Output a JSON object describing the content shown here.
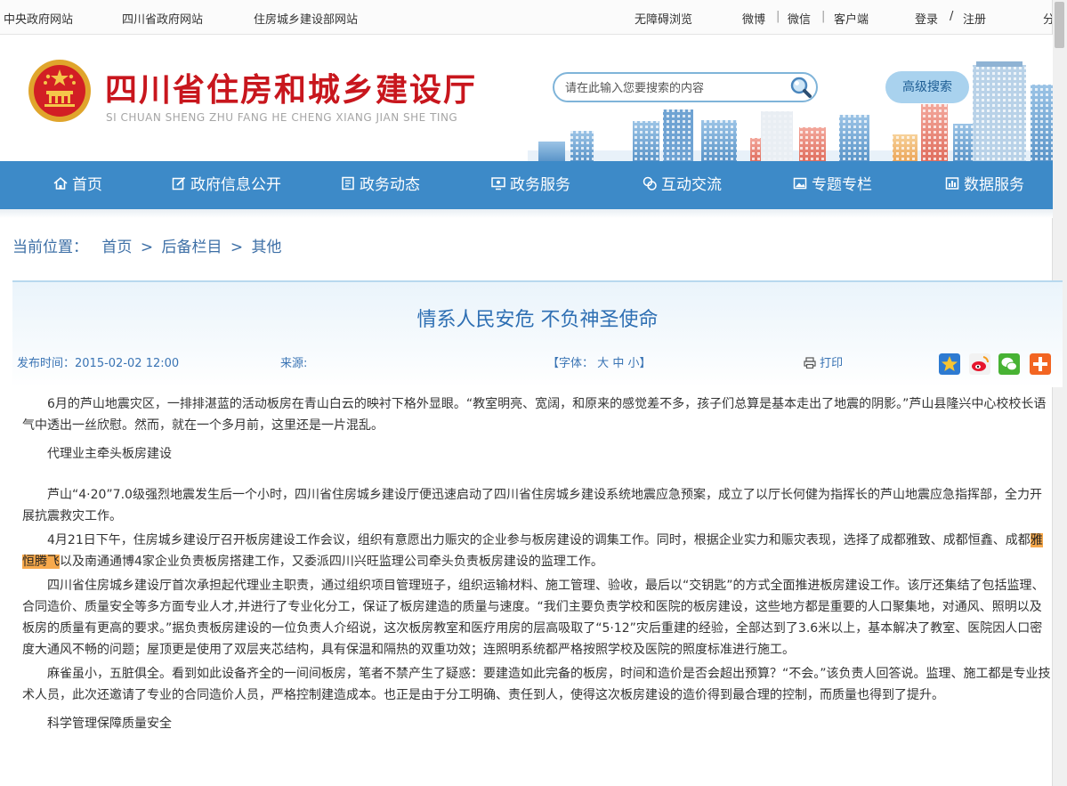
{
  "topbar": {
    "links": [
      "中央政府网站",
      "四川省政府网站",
      "住房城乡建设部网站"
    ],
    "accessibility": "无障碍浏览",
    "weibo": "微博",
    "wechat": "微信",
    "client": "客户端",
    "login": "登录",
    "slash": "/",
    "register": "注册",
    "cut_off": "分",
    "sep": "|"
  },
  "header": {
    "title": "四川省住房和城乡建设厅",
    "pinyin": "SI CHUAN SHENG ZHU FANG HE CHENG XIANG JIAN SHE TING",
    "search_placeholder": "请在此输入您要搜索的内容",
    "advanced_search": "高级搜索"
  },
  "nav": {
    "items": [
      {
        "label": "首页",
        "icon": "home-icon"
      },
      {
        "label": "政府信息公开",
        "icon": "edit-icon"
      },
      {
        "label": "政务动态",
        "icon": "document-icon"
      },
      {
        "label": "政务服务",
        "icon": "monitor-icon"
      },
      {
        "label": "互动交流",
        "icon": "chat-icon"
      },
      {
        "label": "专题专栏",
        "icon": "image-icon"
      },
      {
        "label": "数据服务",
        "icon": "chart-icon"
      }
    ]
  },
  "breadcrumb": {
    "label": "当前位置：",
    "items": [
      "首页",
      "后备栏目",
      "其他"
    ],
    "sep": ">"
  },
  "article": {
    "title": "情系人民安危 不负神圣使命",
    "publish_label": "发布时间：",
    "publish_time": "2015-02-02 12:00",
    "source_label": "来源:",
    "font_label": "【字体：",
    "font_large": "大",
    "font_medium": "中",
    "font_small": "小",
    "font_close": "】",
    "print": "打印",
    "share_icons": [
      "star-share-icon",
      "weibo-share-icon",
      "wechat-share-icon",
      "more-share-icon"
    ],
    "p1": "6月的芦山地震灾区，一排排湛蓝的活动板房在青山白云的映衬下格外显眼。“教室明亮、宽阔，和原来的感觉差不多，孩子们总算是基本走出了地震的阴影。”芦山县隆兴中心校校长语气中透出一丝欣慰。然而，就在一个多月前，这里还是一片混乱。",
    "sub1": "代理业主牵头板房建设",
    "p2": "芦山“4·20”7.0级强烈地震发生后一个小时，四川省住房城乡建设厅便迅速启动了四川省住房城乡建设系统地震应急预案，成立了以厅长何健为指挥长的芦山地震应急指挥部，全力开展抗震救灾工作。",
    "p3_a": "4月21日下午，住房城乡建设厅召开板房建设工作会议，组织有意愿出力赈灾的企业参与板房建设的调集工作。同时，根据企业实力和赈灾表现，选择了成都雅致、成都恒鑫、成都",
    "p3_hl": "雅恒腾飞",
    "p3_b": "以及南通通博4家企业负责板房搭建工作，又委派四川兴旺监理公司牵头负责板房建设的监理工作。",
    "p4": "四川省住房城乡建设厅首次承担起代理业主职责，通过组织项目管理班子，组织运输材料、施工管理、验收，最后以“交钥匙”的方式全面推进板房建设工作。该厅还集结了包括监理、合同造价、质量安全等多方面专业人才,并进行了专业化分工，保证了板房建造的质量与速度。“我们主要负责学校和医院的板房建设，这些地方都是重要的人口聚集地，对通风、照明以及板房的质量有更高的要求。”据负责板房建设的一位负责人介绍说，这次板房教室和医疗用房的层高吸取了“5·12”灾后重建的经验，全部达到了3.6米以上，基本解决了教室、医院因人口密度大通风不畅的问题；屋顶更是使用了双层夹芯结构，具有保温和隔热的双重功效；连照明系统都严格按照学校及医院的照度标准进行施工。",
    "p5": "麻雀虽小，五脏俱全。看到如此设备齐全的一间间板房，笔者不禁产生了疑惑：要建造如此完备的板房，时间和造价是否会超出预算？“不会。”该负责人回答说。监理、施工都是专业技术人员，此次还邀请了专业的合同造价人员，严格控制建造成本。也正是由于分工明确、责任到人，使得这次板房建设的造价得到最合理的控制，而质量也得到了提升。",
    "sub2": "科学管理保障质量安全"
  },
  "colors": {
    "nav_bg": "#3d8ac8",
    "brand_red": "#c8161d",
    "link_blue": "#3d6fa6",
    "highlight": "#f7a94c"
  }
}
